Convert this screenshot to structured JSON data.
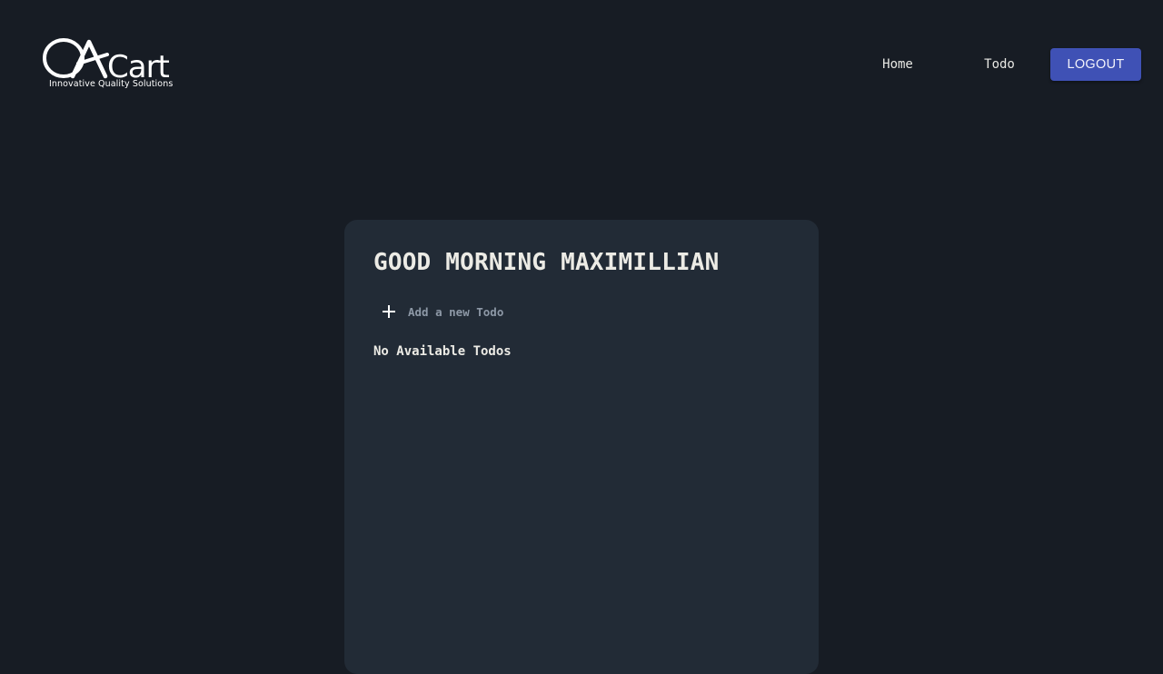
{
  "brand": {
    "logo_text": "QACart",
    "tagline": "Innovative Quality Solutions"
  },
  "nav": {
    "home_label": "Home",
    "todo_label": "Todo",
    "logout_label": "LOGOUT"
  },
  "todo_card": {
    "greeting": "GOOD MORNING MAXIMILLIAN",
    "add_icon": "plus-icon",
    "new_todo_placeholder": "Add a new Todo",
    "new_todo_value": "",
    "empty_message": "No Available Todos"
  },
  "colors": {
    "background": "#171c24",
    "card": "#222b36",
    "accent_button": "#3f51b5",
    "text": "#ecebe5",
    "placeholder": "#8d98a6"
  }
}
